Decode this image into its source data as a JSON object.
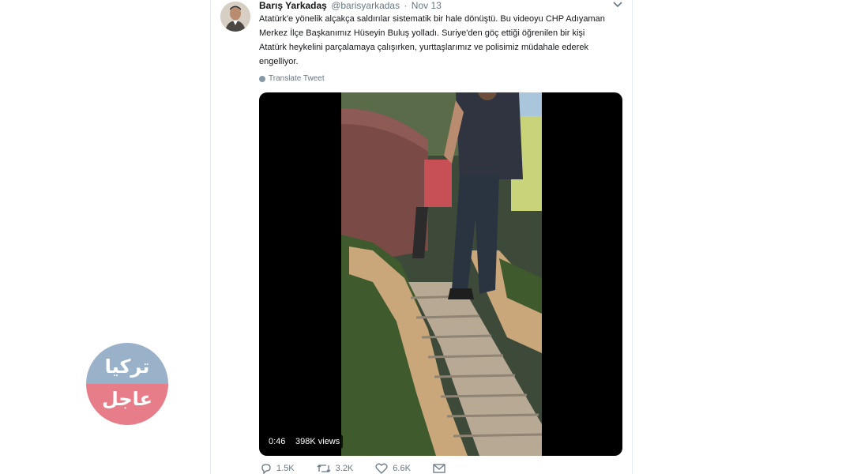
{
  "tweet": {
    "author_name": "Barış Yarkadaş",
    "handle": "@barisyarkadas",
    "separator": "·",
    "date": "Nov 13",
    "text": "Atatürk'e yönelik alçakça saldırılar sistematik bir hale dönüştü. Bu videoyu CHP Adıyaman Merkez İlçe Başkanımız Hüseyin Buluş yolladı. Suriye'den göç ettiği öğrenilen bir kişi Atatürk heykelini parçalamaya çalışırken, yurttaşlarımız ve polisimiz müdahale ederek engelliyor.",
    "translate_label": "Translate Tweet"
  },
  "video": {
    "duration": "0:46",
    "views": "398K views"
  },
  "actions": {
    "replies": "1.5K",
    "retweets": "3.2K",
    "likes": "6.6K"
  },
  "watermark": {
    "line1": "تركيا",
    "line2": "عاجل"
  },
  "colors": {
    "text": "#14171a",
    "muted": "#657786",
    "divider": "#e6ecf0",
    "logo_top": "#9ab2c9",
    "logo_bottom": "#e87d8a"
  }
}
